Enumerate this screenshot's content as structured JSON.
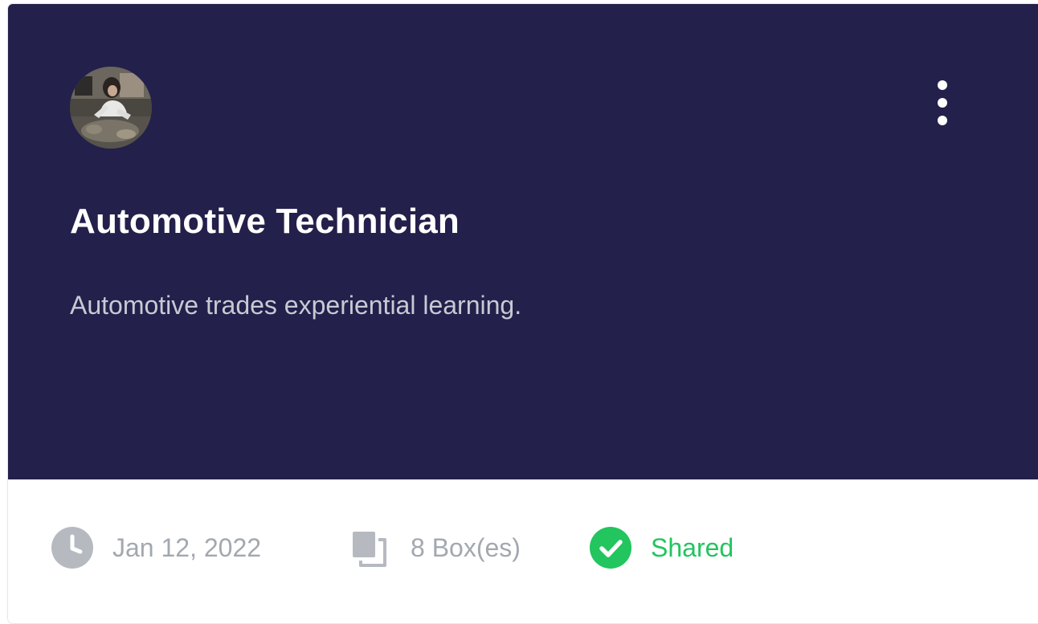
{
  "card": {
    "title": "Automotive Technician",
    "description": "Automotive trades experiential learning.",
    "header_color": "#23204b",
    "avatar_icon": "avatar-photo",
    "menu_icon": "kebab-menu-icon"
  },
  "meta": {
    "date": "Jan 12, 2022",
    "date_icon": "clock-icon",
    "boxes": "8 Box(es)",
    "boxes_icon": "boxes-icon",
    "status": "Shared",
    "status_icon": "check-circle-icon",
    "status_color": "#22c55e",
    "muted_color": "#a3a8b0"
  }
}
